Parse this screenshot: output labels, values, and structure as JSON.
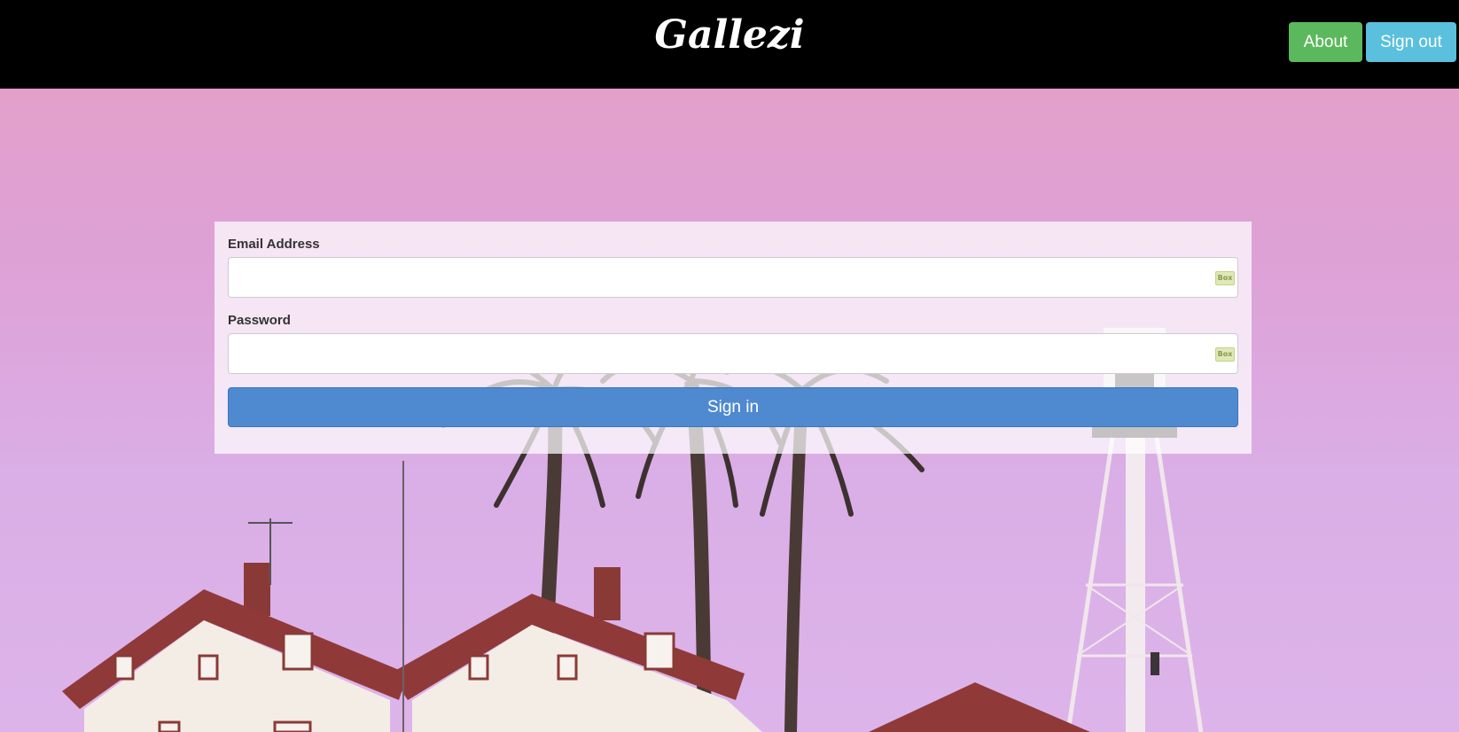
{
  "header": {
    "logo_text": "Gallezi",
    "about_label": "About",
    "signout_label": "Sign out"
  },
  "login": {
    "email_label": "Email Address",
    "email_value": "",
    "password_label": "Password",
    "password_value": "",
    "signin_label": "Sign in",
    "field_icon_text": "Box"
  },
  "colors": {
    "topbar": "#000000",
    "about_button": "#5cb85c",
    "signout_button": "#5bc0de",
    "signin_button": "#4f89cf",
    "background_tint": "#dea1d6"
  },
  "background": {
    "icon": "lighthouse-palm-scene-image"
  }
}
